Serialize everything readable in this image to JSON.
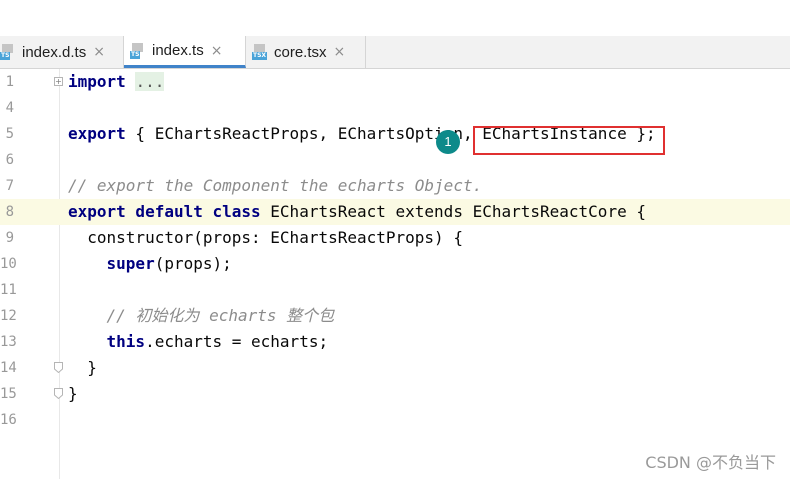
{
  "tabs": [
    {
      "label": "index.d.ts",
      "type": "TS",
      "close": "×",
      "active": false
    },
    {
      "label": "index.ts",
      "type": "TS",
      "close": "×",
      "active": true
    },
    {
      "label": "core.tsx",
      "type": "TSX",
      "close": "×",
      "active": false
    }
  ],
  "lines": [
    {
      "num": "1",
      "keyword": "import",
      "folded": "..."
    },
    {
      "num": "4"
    },
    {
      "num": "5",
      "keyword": "export",
      "rest": " { EChartsReactProps, EChartsOption, EChartsInstance };"
    },
    {
      "num": "6"
    },
    {
      "num": "7",
      "comment": "// export the Component the echarts Object."
    },
    {
      "num": "8",
      "keyword": "export default class",
      "rest": " EChartsReact extends EChartsReactCore {"
    },
    {
      "num": "9",
      "rest": "  constructor(props: EChartsReactProps) {"
    },
    {
      "num": "10",
      "keyword": "    super",
      "rest": "(props);"
    },
    {
      "num": "11"
    },
    {
      "num": "12",
      "comment": "    // 初始化为 echarts 整个包"
    },
    {
      "num": "13",
      "keyword": "    this",
      "rest": ".echarts = echarts;"
    },
    {
      "num": "14",
      "rest": "  }"
    },
    {
      "num": "15",
      "rest": "}"
    },
    {
      "num": "16"
    }
  ],
  "annotation": {
    "marker": "1"
  },
  "watermark": "CSDN @不负当下",
  "colors": {
    "keyword": "#000080",
    "comment": "#8c8c8c",
    "highlight_line": "#fbfae3",
    "tab_underline": "#4083c9",
    "annotation_box": "#e03030",
    "marker": "#0d8a8a"
  }
}
